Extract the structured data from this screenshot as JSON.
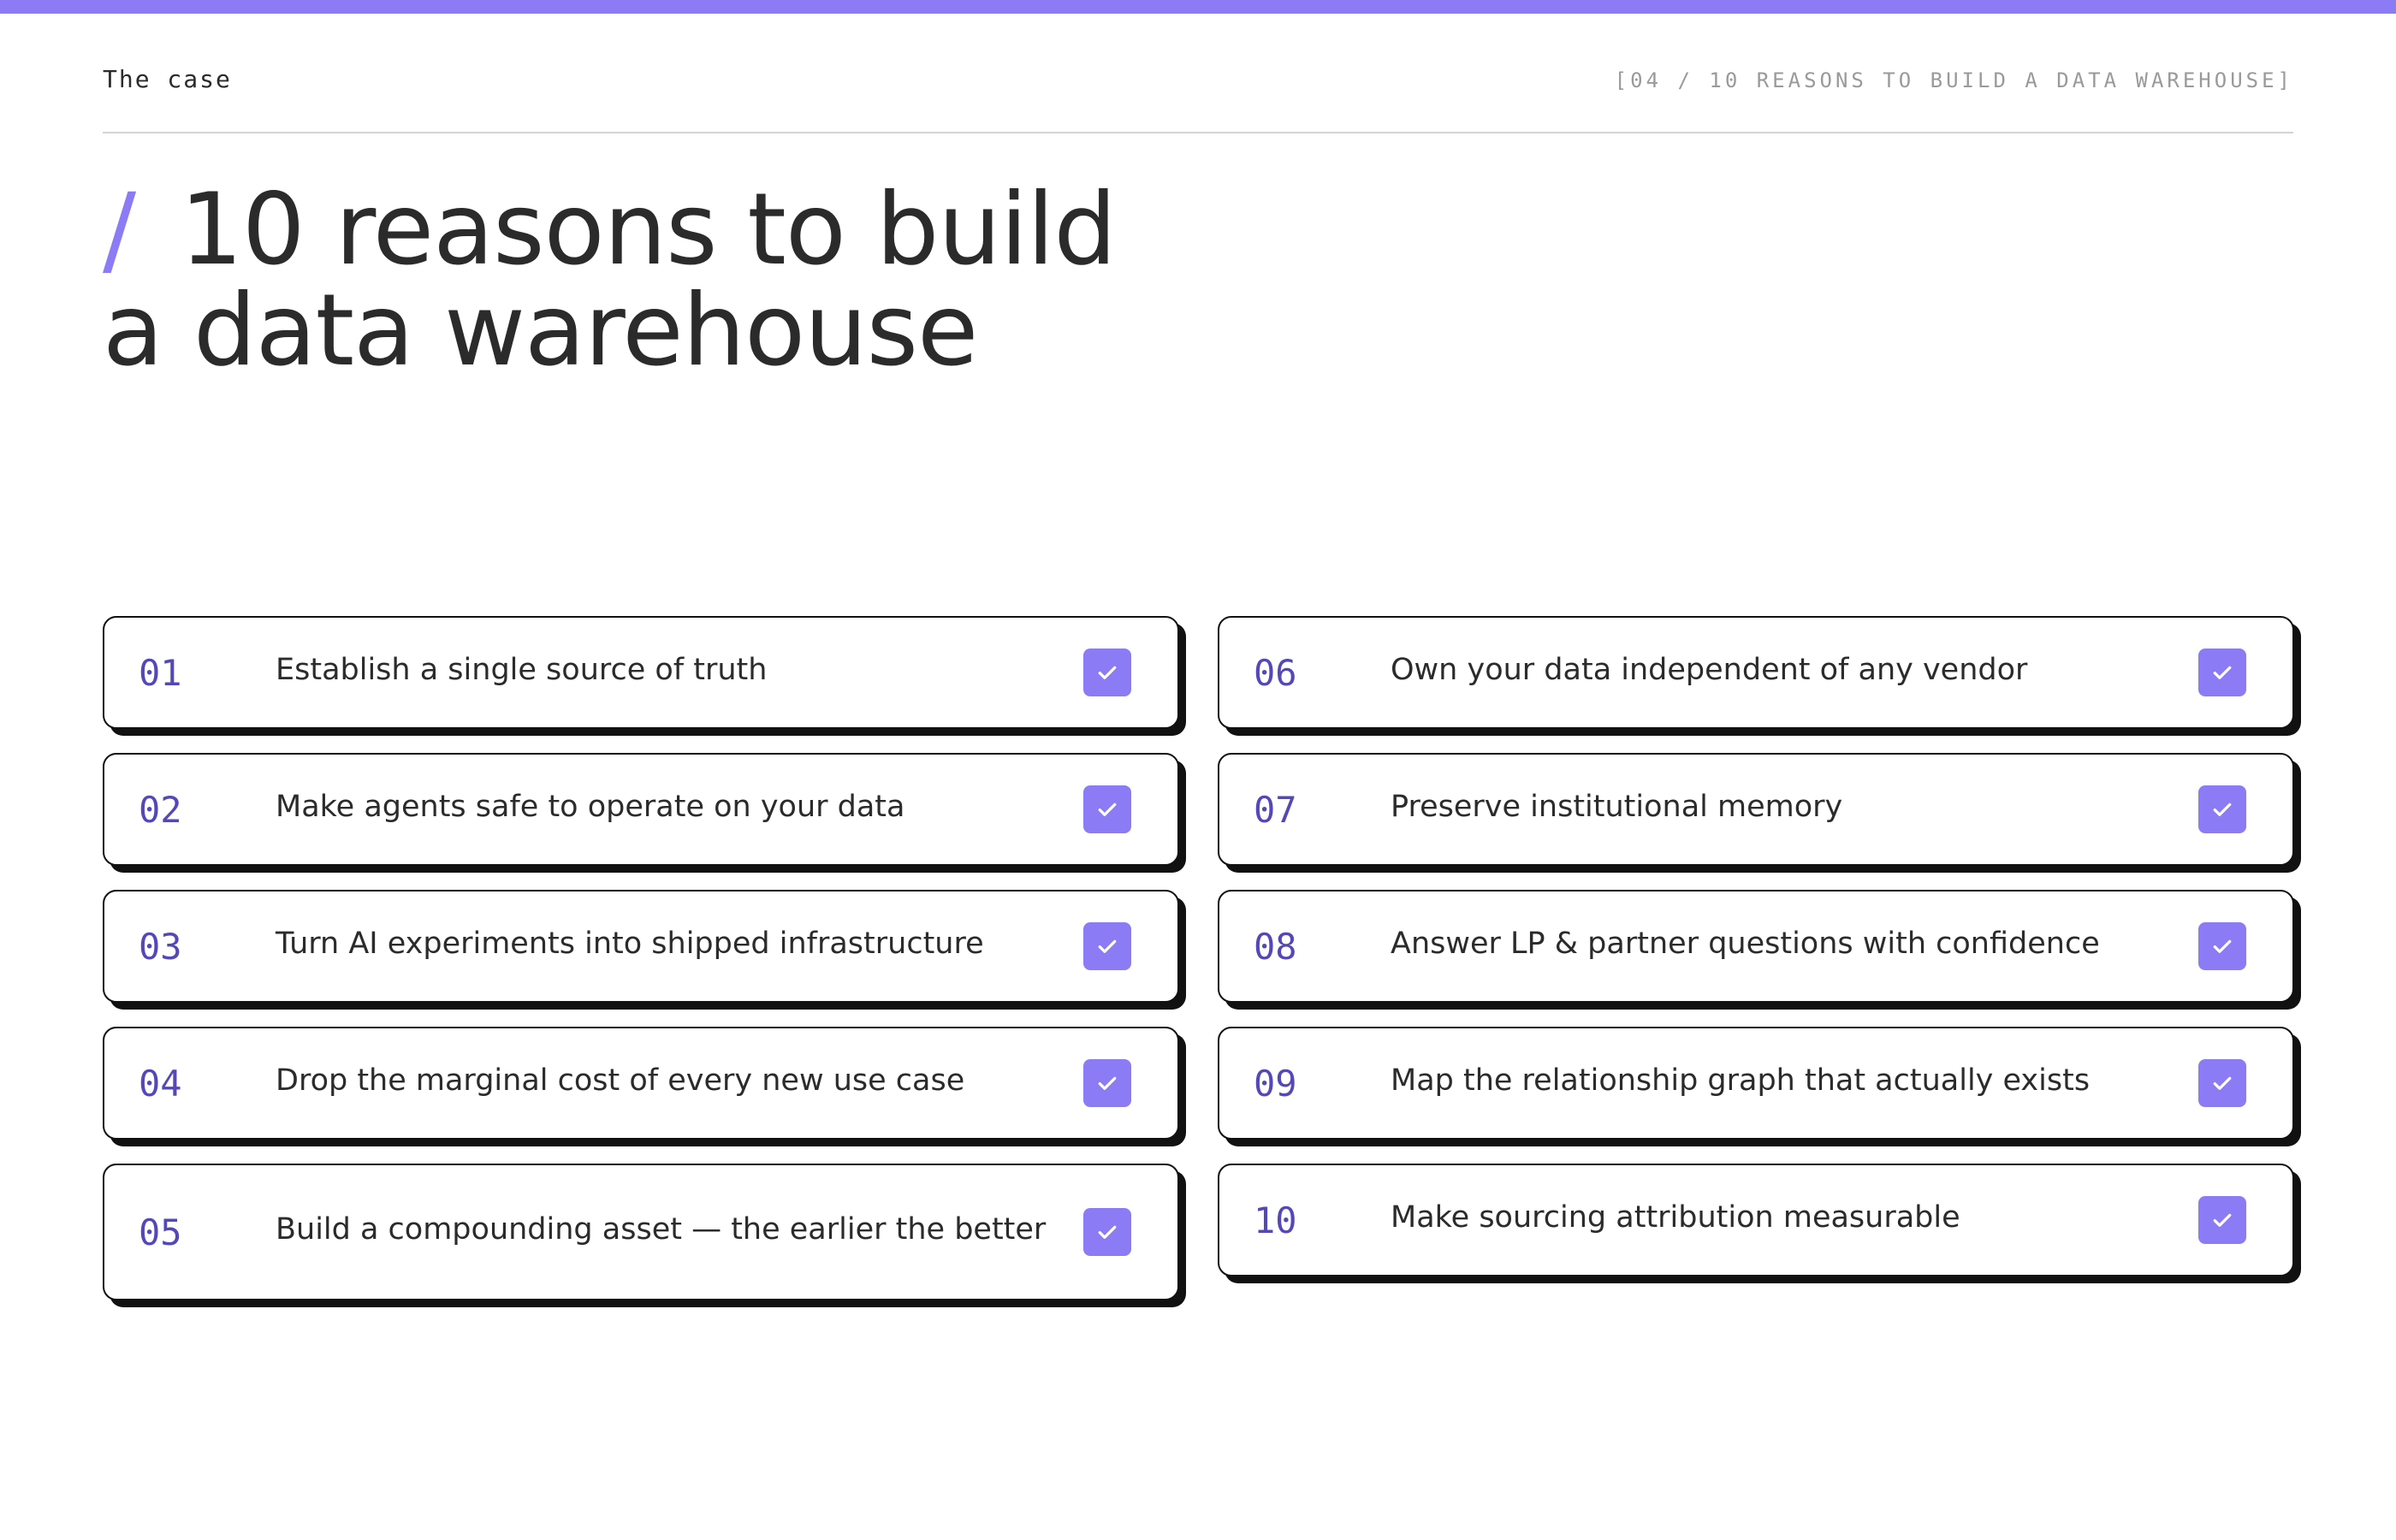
{
  "theme": {
    "accent": "#8b7cf6",
    "number_color": "#5448b8",
    "border": "#111111"
  },
  "header": {
    "section_label": "The case",
    "page_ref": "[04 / 10 REASONS TO BUILD A DATA WAREHOUSE]"
  },
  "title": {
    "slash": "/",
    "line1": "10 reasons to build",
    "line2": "a data warehouse"
  },
  "reasons": [
    {
      "num": "01",
      "text": "Establish a single source of truth",
      "checked": true,
      "icon": "check-icon"
    },
    {
      "num": "02",
      "text": "Make agents safe to operate on your data",
      "checked": true,
      "icon": "check-icon"
    },
    {
      "num": "03",
      "text": "Turn AI experiments into shipped infrastructure",
      "checked": true,
      "icon": "check-icon"
    },
    {
      "num": "04",
      "text": "Drop the marginal cost of every new use case",
      "checked": true,
      "icon": "check-icon"
    },
    {
      "num": "05",
      "text": "Build a compounding asset — the earlier the better",
      "checked": true,
      "icon": "check-icon"
    },
    {
      "num": "06",
      "text": "Own your data independent of any vendor",
      "checked": true,
      "icon": "check-icon"
    },
    {
      "num": "07",
      "text": "Preserve institutional memory",
      "checked": true,
      "icon": "check-icon"
    },
    {
      "num": "08",
      "text": "Answer LP & partner questions with confidence",
      "checked": true,
      "icon": "check-icon"
    },
    {
      "num": "09",
      "text": "Map the relationship graph that actually exists",
      "checked": true,
      "icon": "check-icon"
    },
    {
      "num": "10",
      "text": "Make sourcing attribution measurable",
      "checked": true,
      "icon": "check-icon"
    }
  ]
}
